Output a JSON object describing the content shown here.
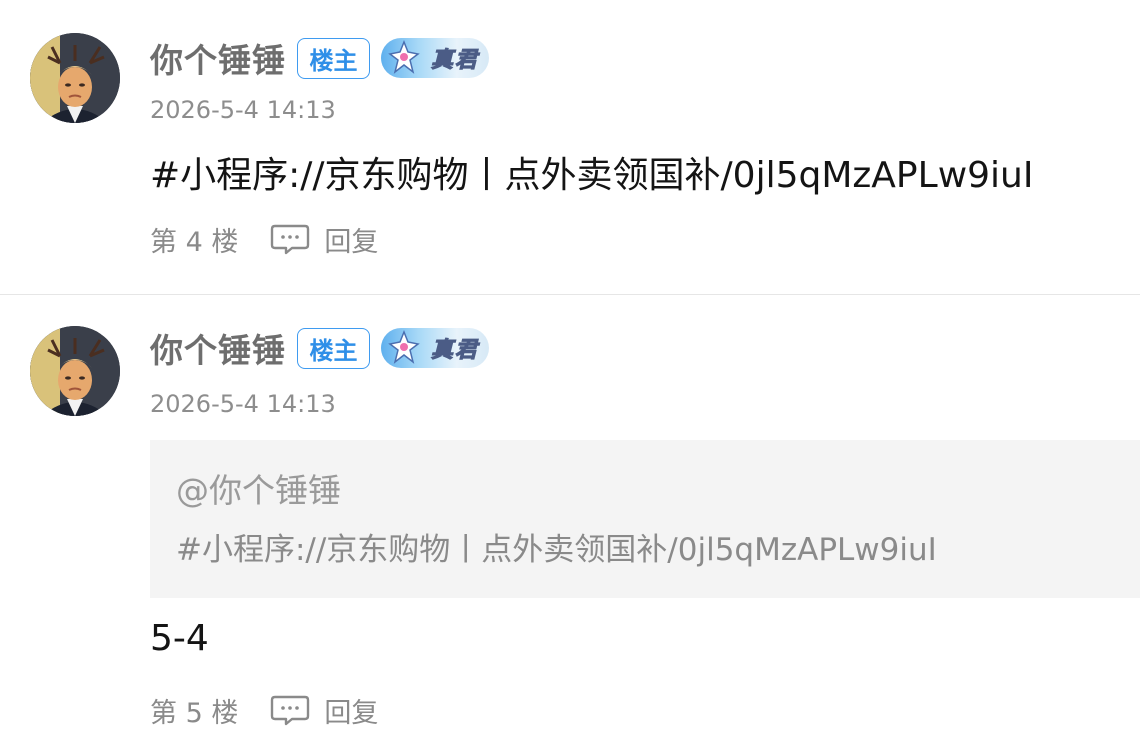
{
  "posts": [
    {
      "username": "你个锤锤",
      "op_badge": "楼主",
      "level_badge": "真君",
      "timestamp": "2026-5-4 14:13",
      "content": "#小程序://京东购物丨点外卖领国补/0jl5qMzAPLw9iuI",
      "floor": "第 4 楼",
      "reply_label": "回复"
    },
    {
      "username": "你个锤锤",
      "op_badge": "楼主",
      "level_badge": "真君",
      "timestamp": "2026-5-4 14:13",
      "quote": {
        "author": "@你个锤锤",
        "text": "#小程序://京东购物丨点外卖领国补/0jl5qMzAPLw9iuI"
      },
      "content": "5-4",
      "floor": "第 5 楼",
      "reply_label": "回复"
    }
  ],
  "colors": {
    "username": "#6e6e6e",
    "op_badge": "#2f8fe8",
    "meta_text": "#8a8a8a",
    "quote_background": "#f4f4f4",
    "divider": "#e6e6e6"
  },
  "icons": {
    "avatar": "user-avatar",
    "level_badge": "level-badge-icon",
    "reply": "comment-bubble-icon"
  }
}
